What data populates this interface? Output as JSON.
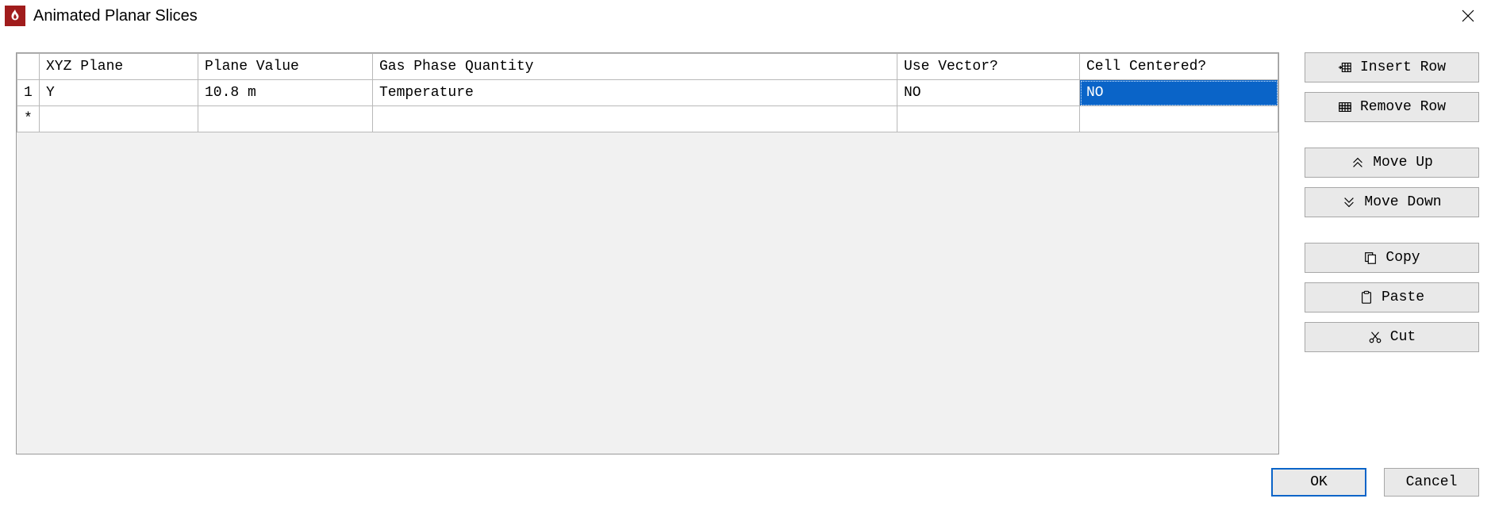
{
  "window": {
    "title": "Animated Planar Slices"
  },
  "table": {
    "headers": {
      "xyz": "XYZ Plane",
      "plane_value": "Plane Value",
      "gas_quantity": "Gas Phase Quantity",
      "use_vector": "Use Vector?",
      "cell_centered": "Cell Centered?"
    },
    "rows": [
      {
        "index": "1",
        "xyz": "Y",
        "plane_value": "10.8 m",
        "gas_quantity": "Temperature",
        "use_vector": "NO",
        "cell_centered": "NO",
        "cell_centered_selected": true
      }
    ],
    "new_row_marker": "*"
  },
  "buttons": {
    "insert_row": "Insert Row",
    "remove_row": "Remove Row",
    "move_up": "Move Up",
    "move_down": "Move Down",
    "copy": "Copy",
    "paste": "Paste",
    "cut": "Cut"
  },
  "footer": {
    "ok": "OK",
    "cancel": "Cancel"
  }
}
